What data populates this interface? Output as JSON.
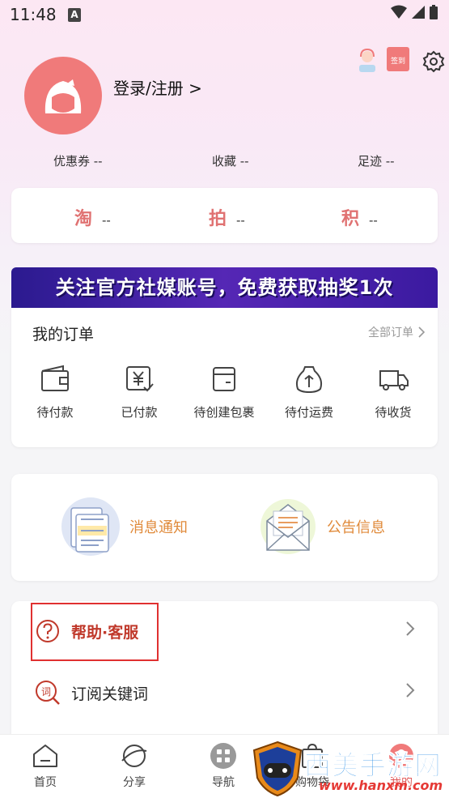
{
  "status_bar": {
    "time": "11:48",
    "notif_icon": "A"
  },
  "profile": {
    "login_label": "登录/注册 >",
    "sign_in_badge": "签到"
  },
  "stats": [
    {
      "label": "优惠券 --"
    },
    {
      "label": "收藏 --"
    },
    {
      "label": "足迹 --"
    }
  ],
  "taopai": [
    {
      "char": "淘",
      "value": "--"
    },
    {
      "char": "拍",
      "value": "--"
    },
    {
      "char": "积",
      "value": "--"
    }
  ],
  "banner": {
    "text": "关注官方社媒账号，免费获取抽奖1次"
  },
  "orders": {
    "title": "我的订单",
    "all_label": "全部订单",
    "items": [
      {
        "label": "待付款",
        "icon": "wallet-icon"
      },
      {
        "label": "已付款",
        "icon": "paid-yen-icon"
      },
      {
        "label": "待创建包裹",
        "icon": "package-icon"
      },
      {
        "label": "待付运费",
        "icon": "money-bag-icon"
      },
      {
        "label": "待收货",
        "icon": "truck-icon"
      }
    ]
  },
  "notices": [
    {
      "label": "消息通知",
      "icon": "message-doc-icon"
    },
    {
      "label": "公告信息",
      "icon": "envelope-icon"
    }
  ],
  "menu": [
    {
      "label": "帮助·客服",
      "icon": "question-circle-icon",
      "highlighted": true
    },
    {
      "label": "订阅关键词",
      "icon": "keyword-search-icon"
    }
  ],
  "tabbar": [
    {
      "label": "首页",
      "icon": "home-icon"
    },
    {
      "label": "分享",
      "icon": "planet-icon"
    },
    {
      "label": "导航",
      "icon": "grid-icon"
    },
    {
      "label": "购物袋",
      "icon": "bag-icon"
    },
    {
      "label": "我的",
      "icon": "profile-icon"
    }
  ],
  "watermark": {
    "text": "西美手游网",
    "url": "www.hanxm.com"
  },
  "colors": {
    "accent_pink": "#f07a7a",
    "help_border": "#e03030",
    "notice_orange": "#e08a3a",
    "banner_purple": "#4a22b0"
  }
}
